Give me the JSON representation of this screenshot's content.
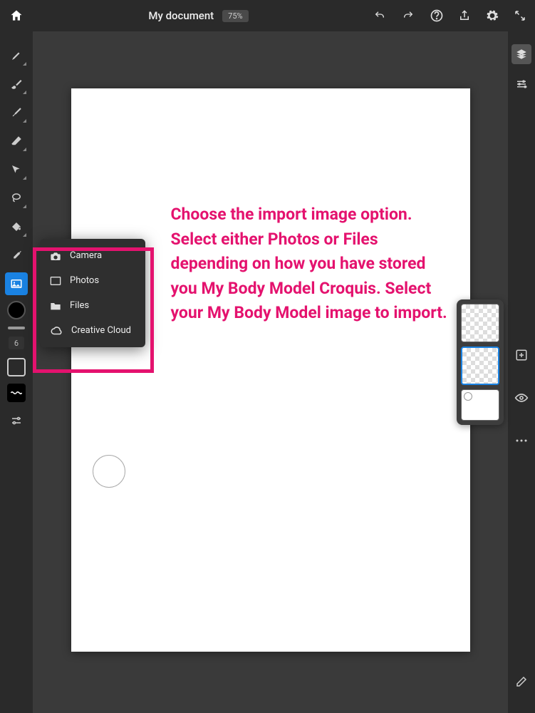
{
  "topbar": {
    "doc_title": "My document",
    "zoom": "75%"
  },
  "popup": {
    "items": [
      {
        "label": "Camera",
        "icon": "camera-icon"
      },
      {
        "label": "Photos",
        "icon": "photos-icon"
      },
      {
        "label": "Files",
        "icon": "files-icon"
      },
      {
        "label": "Creative Cloud",
        "icon": "cc-icon"
      }
    ]
  },
  "toolbar": {
    "brush_size": "6"
  },
  "instruction_text": "Choose the import image option.  Select either Photos or Files depending on how you have stored you My Body Model Croquis.  Select your My Body Model image to import.",
  "colors": {
    "accent": "#e4126e",
    "selection": "#1a82e2"
  }
}
